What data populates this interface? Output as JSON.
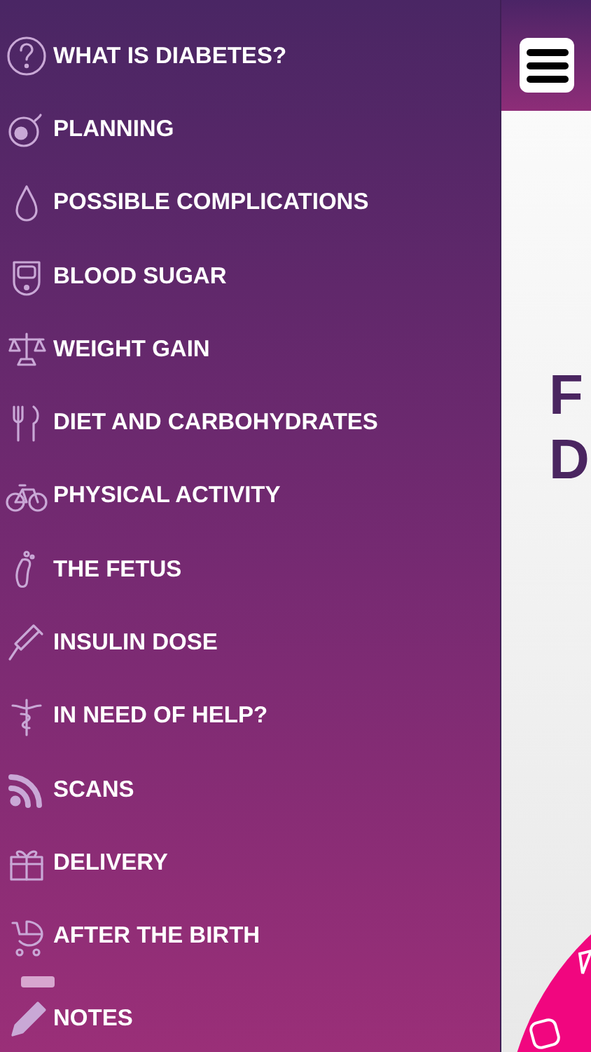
{
  "menu": {
    "items": [
      {
        "label": "WHAT IS DIABETES?"
      },
      {
        "label": "PLANNING"
      },
      {
        "label": "POSSIBLE COMPLICATIONS"
      },
      {
        "label": "BLOOD SUGAR"
      },
      {
        "label": "WEIGHT GAIN"
      },
      {
        "label": "DIET AND CARBOHYDRATES"
      },
      {
        "label": "PHYSICAL ACTIVITY"
      },
      {
        "label": "THE FETUS"
      },
      {
        "label": "INSULIN DOSE"
      },
      {
        "label": "IN NEED OF HELP?"
      },
      {
        "label": "SCANS"
      },
      {
        "label": "DELIVERY"
      },
      {
        "label": "AFTER THE BIRTH"
      },
      {
        "label": "NOTES"
      }
    ]
  },
  "main": {
    "title_lines": [
      "F",
      "D"
    ]
  }
}
